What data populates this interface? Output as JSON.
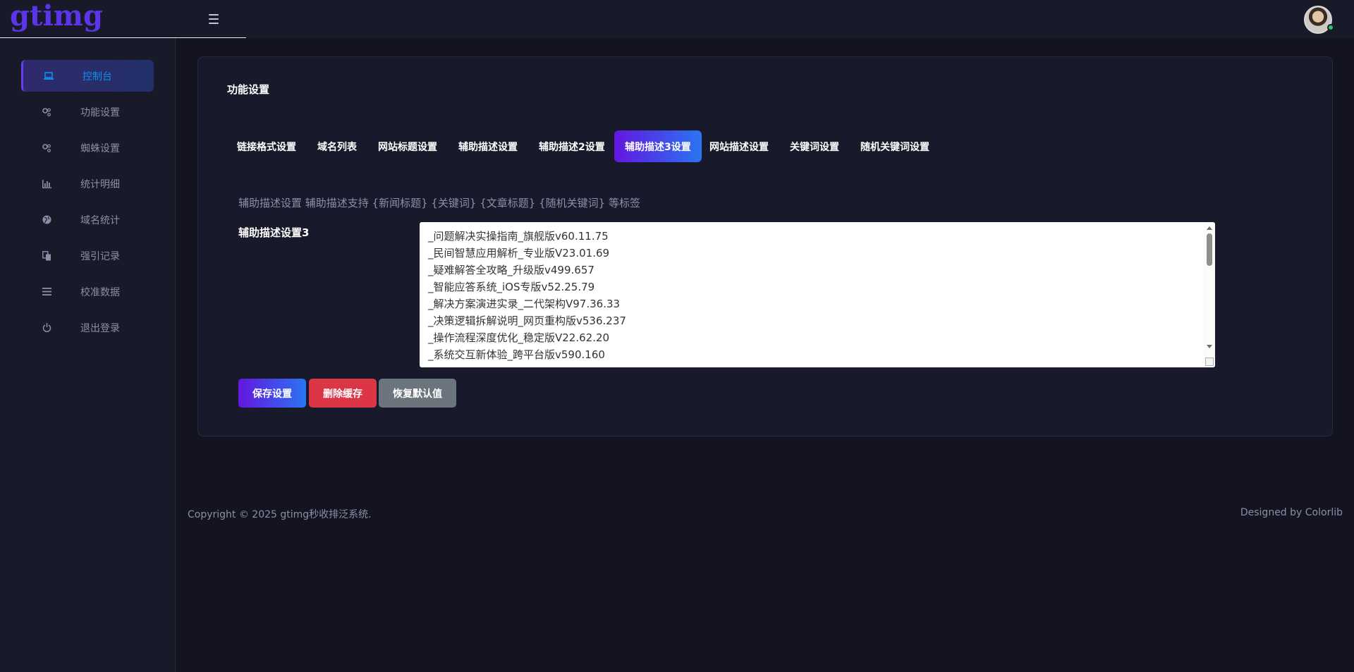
{
  "header": {
    "logo": "gtimg"
  },
  "sidebar": {
    "items": [
      {
        "label": "控制台",
        "icon": "laptop-icon"
      },
      {
        "label": "功能设置",
        "icon": "cogs-icon"
      },
      {
        "label": "蜘蛛设置",
        "icon": "cogs-icon"
      },
      {
        "label": "统计明细",
        "icon": "bar-chart-icon"
      },
      {
        "label": "域名统计",
        "icon": "globe-icon"
      },
      {
        "label": "强引记录",
        "icon": "copy-icon"
      },
      {
        "label": "校准数据",
        "icon": "list-icon"
      },
      {
        "label": "退出登录",
        "icon": "power-icon"
      }
    ]
  },
  "main": {
    "title": "功能设置",
    "tabs": [
      {
        "label": "链接格式设置"
      },
      {
        "label": "域名列表"
      },
      {
        "label": "网站标题设置"
      },
      {
        "label": "辅助描述设置"
      },
      {
        "label": "辅助描述2设置"
      },
      {
        "label": "辅助描述3设置"
      },
      {
        "label": "网站描述设置"
      },
      {
        "label": "关键词设置"
      },
      {
        "label": "随机关键词设置"
      }
    ],
    "active_tab": "辅助描述3设置",
    "hint": "辅助描述设置 辅助描述支持 {新闻标题} {关键词} {文章标题} {随机关键词} 等标签",
    "field_label": "辅助描述设置3",
    "textarea_lines": [
      "_问题解决实操指南_旗舰版v60.11.75",
      "_民间智慧应用解析_专业版V23.01.69",
      "_疑难解答全攻略_升级版v499.657",
      "_智能应答系统_iOS专版v52.25.79",
      "_解决方案演进实录_二代架构V97.36.33",
      "_决策逻辑拆解说明_网页重构版v536.237",
      "_操作流程深度优化_稳定版V22.62.20",
      "_系统交互新体验_跨平台版v590.160"
    ],
    "buttons": {
      "save": "保存设置",
      "delete": "删除缓存",
      "reset": "恢复默认值"
    }
  },
  "footer": {
    "copyright": "Copyright © 2025 gtimg秒收排泛系统.",
    "designer": "Designed by Colorlib"
  },
  "colors": {
    "accent_gradient_start": "#6317e0",
    "accent_gradient_end": "#2a74f2",
    "danger": "#dc3545",
    "secondary": "#6c757d",
    "background": "#13141f",
    "panel": "#181a29"
  }
}
